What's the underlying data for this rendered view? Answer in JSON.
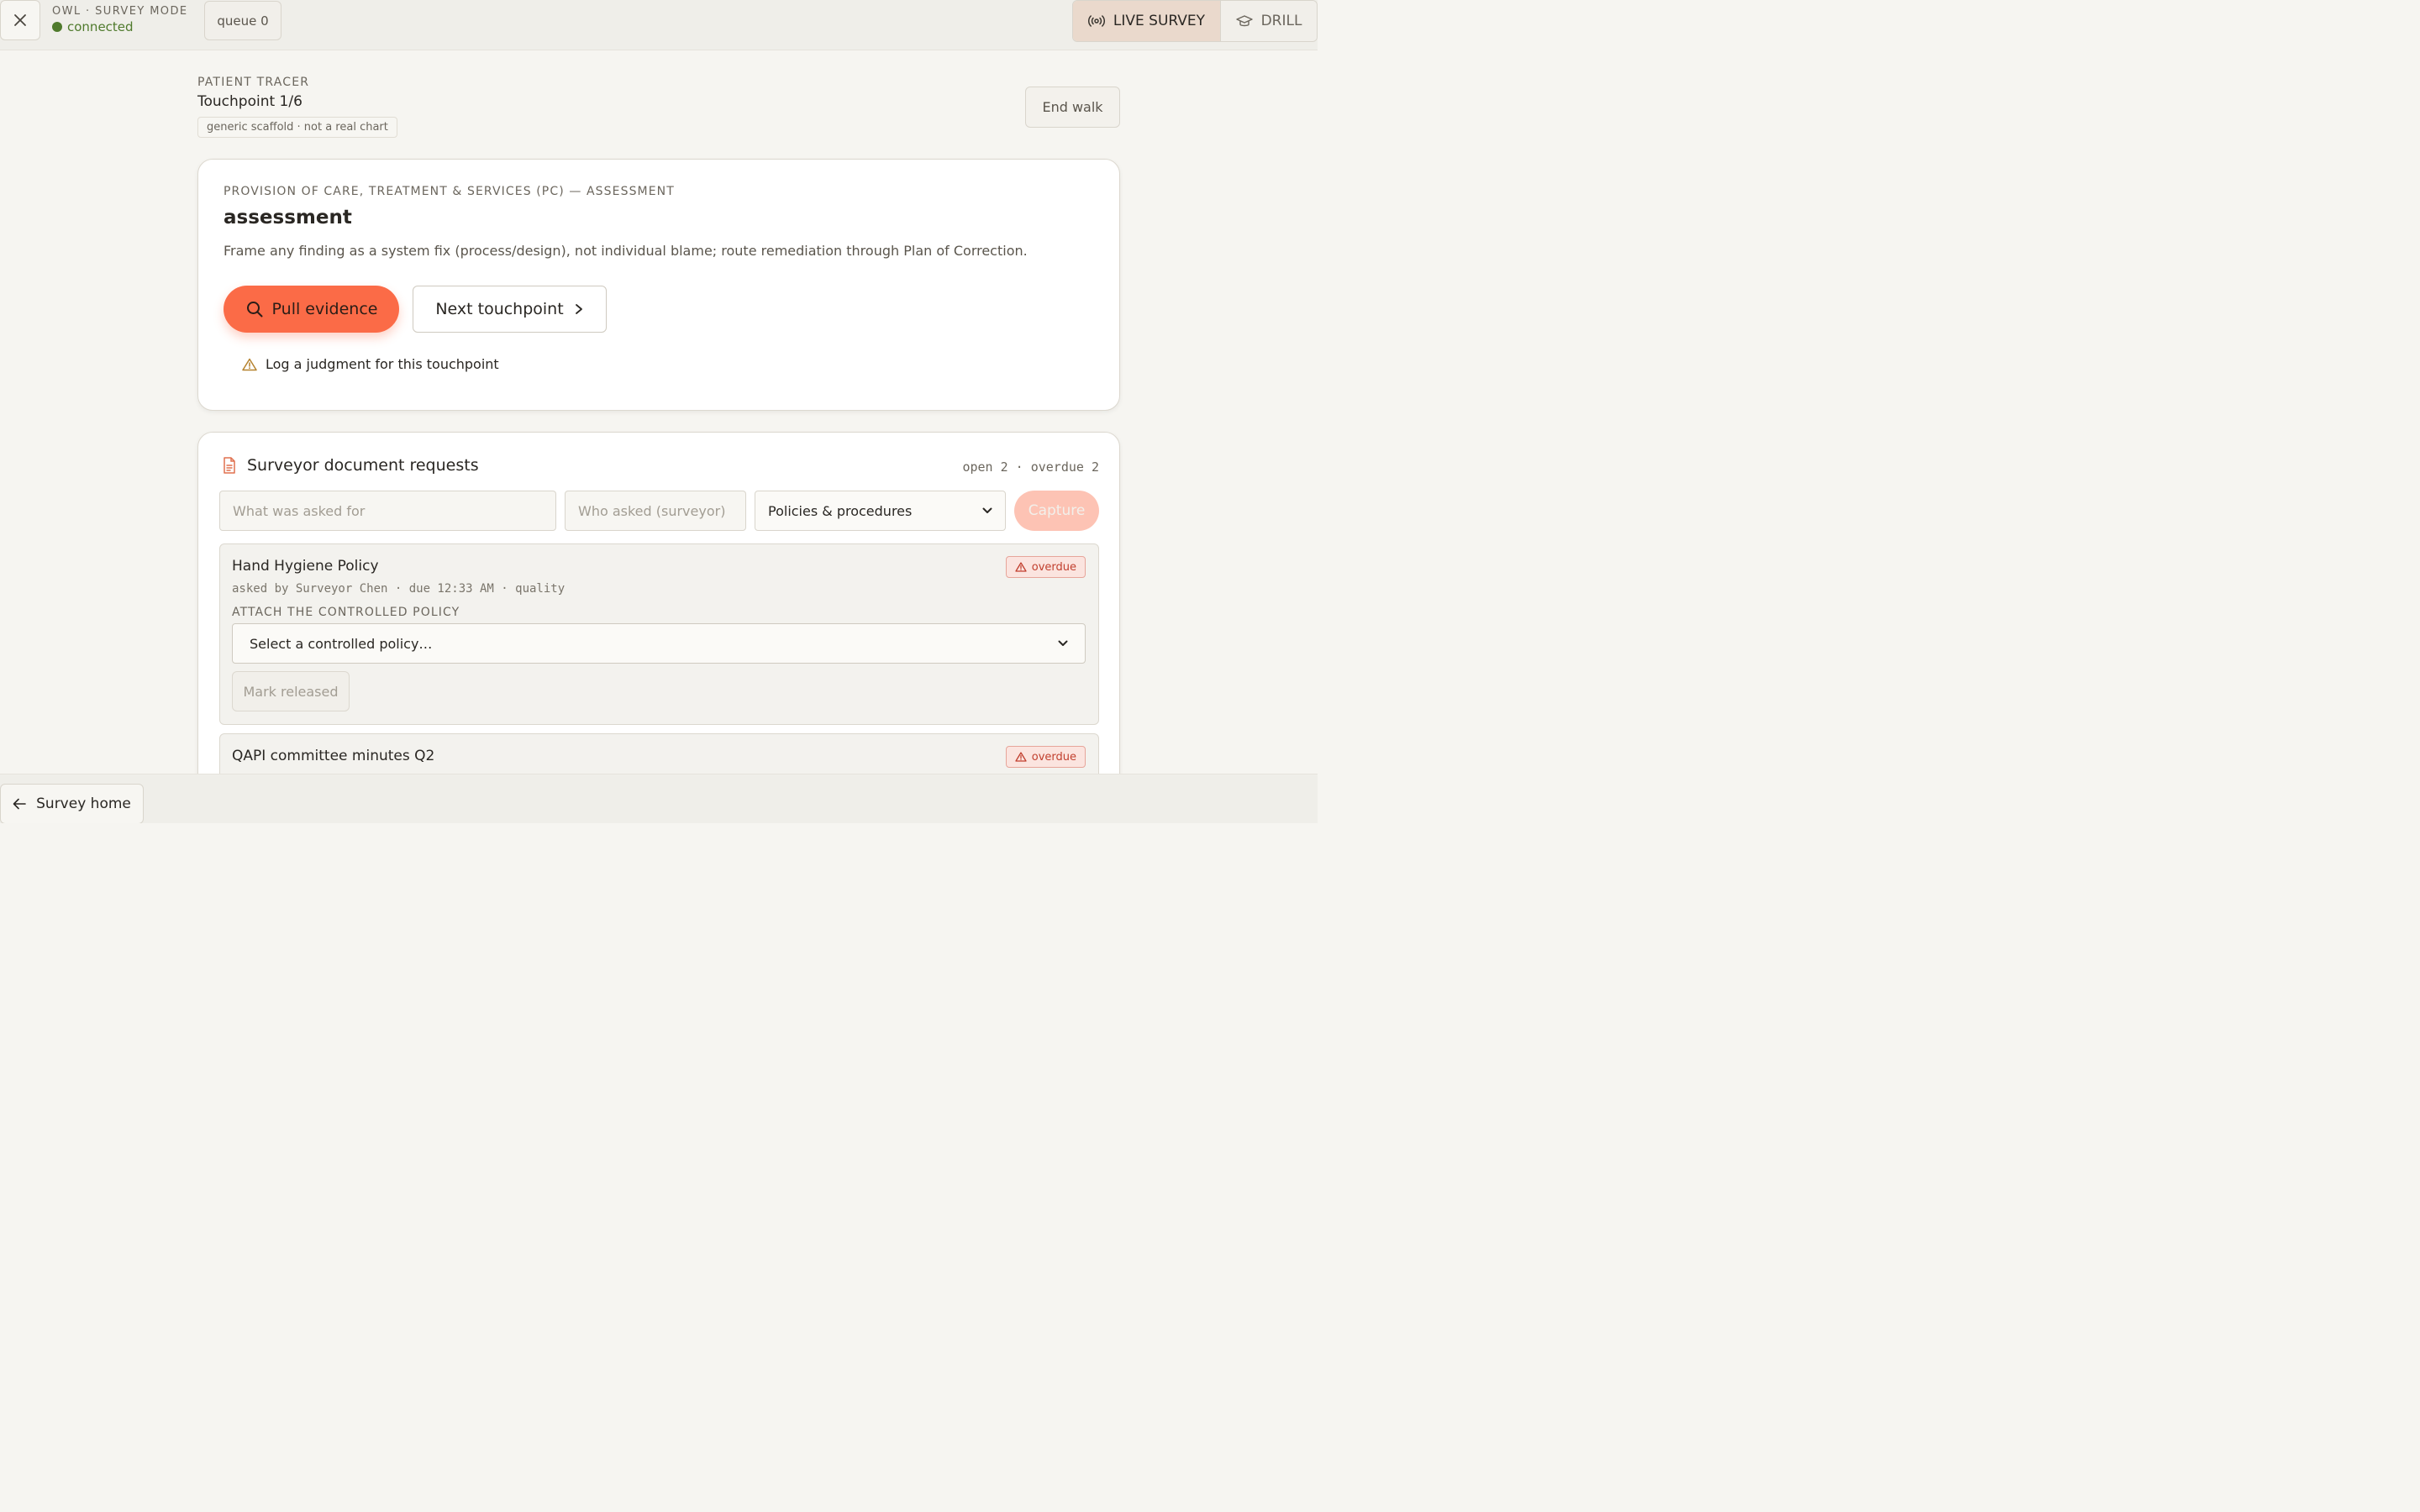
{
  "topbar": {
    "app_title": "OWL · SURVEY MODE",
    "status": "connected",
    "queue_label": "queue 0",
    "mode_live": "LIVE SURVEY",
    "mode_drill": "DRILL"
  },
  "tracer": {
    "eyebrow": "PATIENT TRACER",
    "step": "Touchpoint 1/6",
    "tag": "generic scaffold · not a real chart",
    "end_walk": "End walk"
  },
  "assessment": {
    "eyebrow": "PROVISION OF CARE, TREATMENT & SERVICES (PC) — ASSESSMENT",
    "title": "assessment",
    "description": "Frame any finding as a system fix (process/design), not individual blame; route remediation through Plan of Correction.",
    "pull_evidence": "Pull evidence",
    "next_touchpoint": "Next touchpoint",
    "judgment": "Log a judgment for this touchpoint"
  },
  "docs": {
    "title": "Surveyor document requests",
    "counts": "open 2 · overdue 2",
    "what_placeholder": "What was asked for",
    "who_placeholder": "Who asked (surveyor)",
    "category_selected": "Policies & procedures",
    "capture": "Capture",
    "requests": [
      {
        "title": "Hand Hygiene Policy",
        "meta": "asked by Surveyor Chen · due 12:33 AM · quality",
        "badge": "overdue",
        "attach_label": "ATTACH THE CONTROLLED POLICY",
        "select_placeholder": "Select a controlled policy…",
        "mark_released": "Mark released"
      },
      {
        "title": "QAPI committee minutes Q2",
        "badge": "overdue"
      }
    ]
  },
  "footer": {
    "survey_home": "Survey home"
  },
  "colors": {
    "accent": "#fb6b47",
    "connected": "#4f7a2c",
    "overdue": "#c13f2e"
  }
}
